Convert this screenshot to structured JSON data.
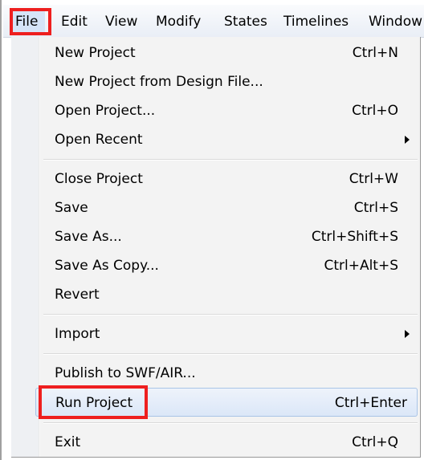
{
  "menubar": {
    "items": [
      "File",
      "Edit",
      "View",
      "Modify",
      "States",
      "Timelines",
      "Window"
    ]
  },
  "file_menu": {
    "groups": [
      [
        {
          "label": "New Project",
          "shortcut": "Ctrl+N"
        },
        {
          "label": "New Project from Design File...",
          "shortcut": ""
        },
        {
          "label": "Open Project...",
          "shortcut": "Ctrl+O"
        },
        {
          "label": "Open Recent",
          "shortcut": "",
          "submenu": true
        }
      ],
      [
        {
          "label": "Close Project",
          "shortcut": "Ctrl+W"
        },
        {
          "label": "Save",
          "shortcut": "Ctrl+S"
        },
        {
          "label": "Save As...",
          "shortcut": "Ctrl+Shift+S"
        },
        {
          "label": "Save As Copy...",
          "shortcut": "Ctrl+Alt+S"
        },
        {
          "label": "Revert",
          "shortcut": ""
        }
      ],
      [
        {
          "label": "Import",
          "shortcut": "",
          "submenu": true
        }
      ],
      [
        {
          "label": "Publish to SWF/AIR...",
          "shortcut": ""
        },
        {
          "label": "Run Project",
          "shortcut": "Ctrl+Enter",
          "hovered": true
        }
      ],
      [
        {
          "label": "Exit",
          "shortcut": "Ctrl+Q"
        }
      ]
    ]
  },
  "colors": {
    "highlight_box": "#ee1f1f",
    "hover_fill": "#dbe7f8",
    "menu_background": "#f3f3f3"
  }
}
